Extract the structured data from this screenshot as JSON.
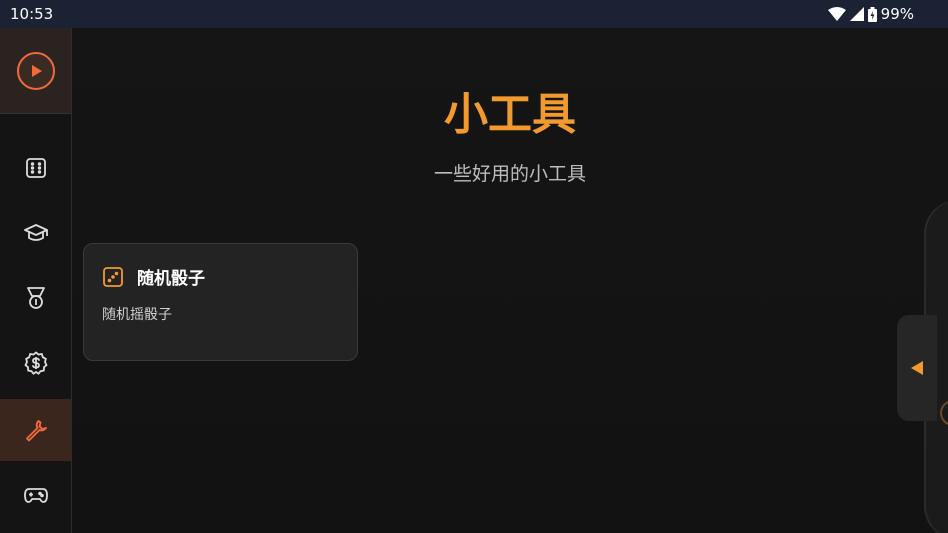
{
  "status": {
    "time": "10:53",
    "battery": "99%"
  },
  "sidebar": {
    "top_icon": "play-icon",
    "items": [
      {
        "icon": "dice-icon"
      },
      {
        "icon": "graduation-cap-icon"
      },
      {
        "icon": "medal-icon"
      },
      {
        "icon": "dollar-coin-icon"
      },
      {
        "icon": "wrench-icon",
        "active": true
      },
      {
        "icon": "gamepad-icon"
      }
    ]
  },
  "main": {
    "title": "小工具",
    "subtitle": "一些好用的小工具",
    "tools": [
      {
        "icon": "dice-icon",
        "title": "随机骰子",
        "description": "随机摇骰子"
      }
    ]
  },
  "colors": {
    "accent": "#f39a2e",
    "active_icon": "#f26a3c",
    "statusbar": "#1a2233"
  }
}
